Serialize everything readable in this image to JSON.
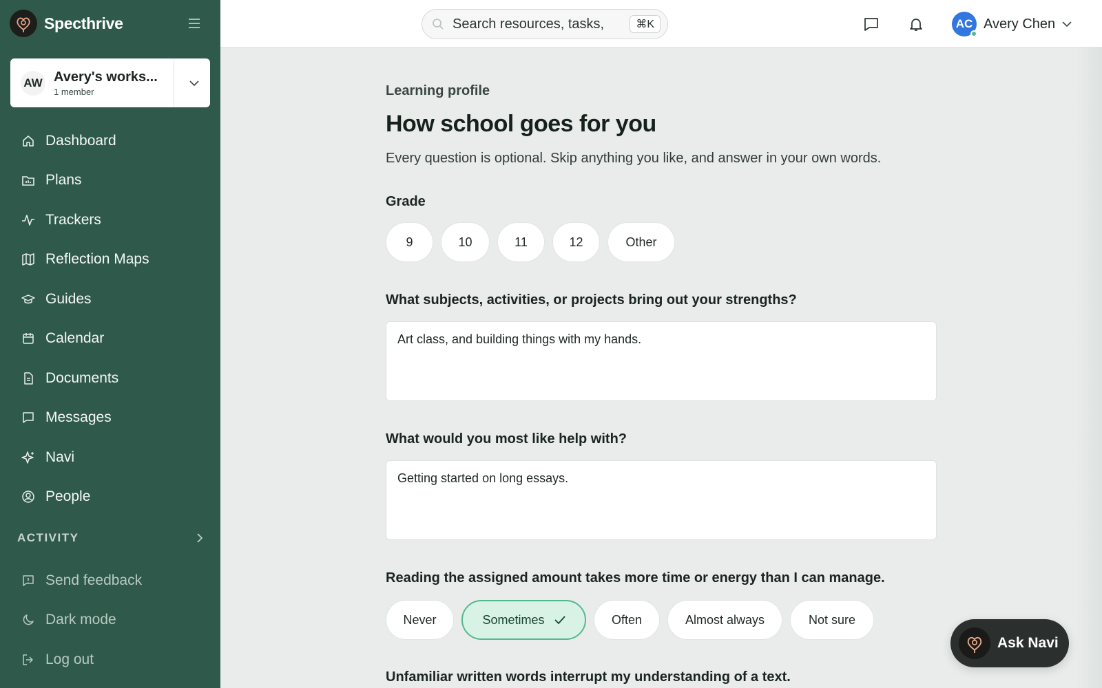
{
  "brand": {
    "name": "Specthrive"
  },
  "workspace": {
    "initials": "AW",
    "name": "Avery's works...",
    "members": "1 member"
  },
  "nav": {
    "items": [
      {
        "label": "Dashboard",
        "icon": "home-icon"
      },
      {
        "label": "Plans",
        "icon": "folder-chart-icon"
      },
      {
        "label": "Trackers",
        "icon": "activity-icon"
      },
      {
        "label": "Reflection Maps",
        "icon": "map-icon"
      },
      {
        "label": "Guides",
        "icon": "graduation-cap-icon"
      },
      {
        "label": "Calendar",
        "icon": "calendar-icon"
      },
      {
        "label": "Documents",
        "icon": "document-icon"
      },
      {
        "label": "Messages",
        "icon": "message-icon"
      },
      {
        "label": "Navi",
        "icon": "sparkle-icon"
      },
      {
        "label": "People",
        "icon": "person-circle-icon"
      }
    ],
    "section_label": "ACTIVITY",
    "bottom_items": [
      {
        "label": "Send feedback",
        "icon": "feedback-icon"
      },
      {
        "label": "Dark mode",
        "icon": "moon-icon"
      },
      {
        "label": "Log out",
        "icon": "logout-icon"
      }
    ]
  },
  "topbar": {
    "search_placeholder": "Search resources, tasks,",
    "shortcut": "⌘K",
    "user_initials": "AC",
    "user_name": "Avery Chen"
  },
  "page": {
    "eyebrow": "Learning profile",
    "title": "How school goes for you",
    "subtitle": "Every question is optional. Skip anything you like, and answer in your own words."
  },
  "grade": {
    "label": "Grade",
    "options": [
      "9",
      "10",
      "11",
      "12",
      "Other"
    ]
  },
  "strengths": {
    "label": "What subjects, activities, or projects bring out your strengths?",
    "answer": "Art class, and building things with my hands."
  },
  "help": {
    "label": "What would you most like help with?",
    "answer": "Getting started on long essays."
  },
  "reading": {
    "label": "Reading the assigned amount takes more time or energy than I can manage.",
    "options": [
      "Never",
      "Sometimes",
      "Often",
      "Almost always",
      "Not sure"
    ],
    "selected": "Sometimes"
  },
  "words": {
    "label": "Unfamiliar written words interrupt my understanding of a text."
  },
  "ask_navi": {
    "label": "Ask Navi"
  },
  "colors": {
    "sidebar": "#2f5a4b",
    "accent": "#53b98d",
    "selected_bg": "#d9f2e6",
    "avatar": "#3276e0"
  }
}
